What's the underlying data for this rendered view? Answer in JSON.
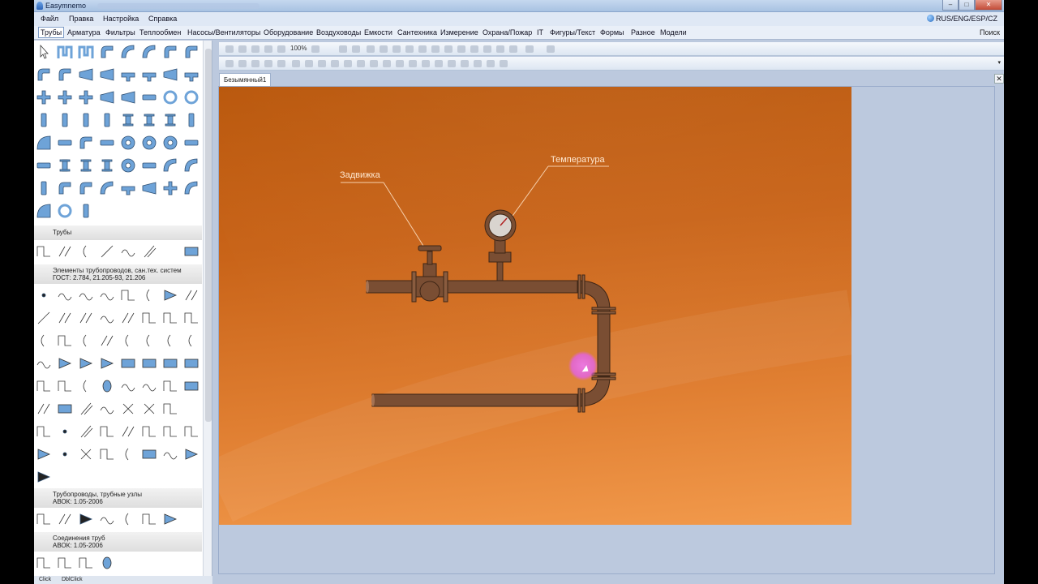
{
  "window": {
    "title": "Easymnemo",
    "controls": {
      "minimize": "–",
      "maximize": "□",
      "close": "✕"
    }
  },
  "menu": {
    "items": [
      "Файл",
      "Правка",
      "Настройка",
      "Справка"
    ],
    "language": "RUS/ENG/ESP/CZ"
  },
  "categories": {
    "items": [
      "Трубы",
      "Арматура",
      "Фильтры",
      "Теплообмен",
      "Насосы/Вентиляторы",
      "Оборудование",
      "Воздуховоды",
      "Емкости",
      "Сантехника",
      "Измерение",
      "Охрана/Пожар",
      "IT",
      "Фигуры/Текст",
      "Формы",
      "Разное",
      "Модели"
    ],
    "active": "Трубы",
    "search_label": "Поиск"
  },
  "palette": {
    "sections": [
      {
        "line1": "Трубы",
        "line2": ""
      },
      {
        "line1": "Элементы трубопроводов, сан.тех. систем",
        "line2": "ГОСТ: 2.784, 21.205-93, 21.206"
      },
      {
        "line1": "Трубопроводы, трубные узлы",
        "line2": "АВОК: 1.05-2006"
      },
      {
        "line1": "Соединения труб",
        "line2": "АВОК: 1.05-2006"
      }
    ]
  },
  "statusbar": {
    "click": "Click",
    "dblclick": "DblClick"
  },
  "toolbar": {
    "zoom_label": "100%"
  },
  "document": {
    "tab_label": "Безымянный1",
    "close_label": "✕"
  },
  "scheme": {
    "labels": {
      "valve": "Задвижка",
      "temperature": "Температура"
    }
  },
  "colors": {
    "pipe": "#7a4e33",
    "pipe_outline": "#3f2616",
    "canvas_top": "#b9560a",
    "canvas_bottom": "#f29a4c",
    "tile_blue": "#6ea3d8",
    "cursor_highlight": "#e06ae0"
  }
}
